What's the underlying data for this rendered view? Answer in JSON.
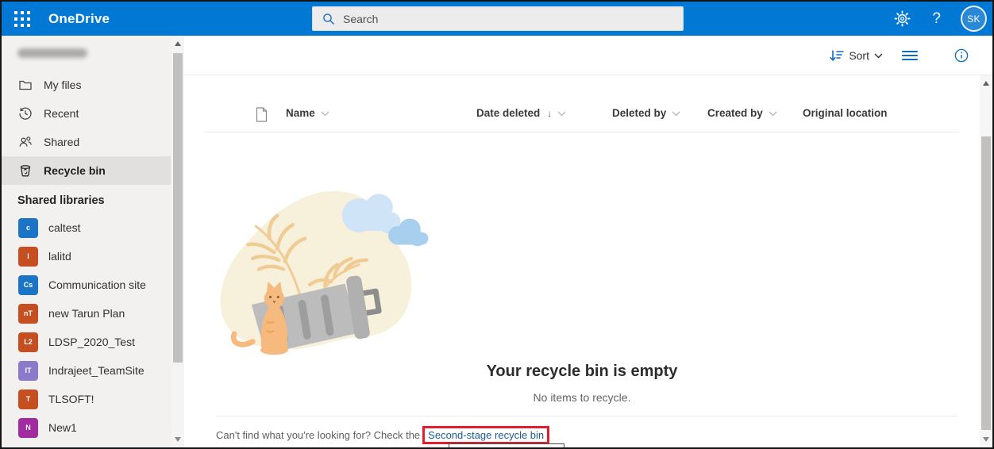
{
  "header": {
    "app_name": "OneDrive",
    "search_placeholder": "Search",
    "help_label": "?",
    "avatar_initials": "SK"
  },
  "sidebar": {
    "nav": [
      {
        "label": "My files",
        "icon": "folder-icon",
        "selected": false
      },
      {
        "label": "Recent",
        "icon": "recent-icon",
        "selected": false
      },
      {
        "label": "Shared",
        "icon": "shared-icon",
        "selected": false
      },
      {
        "label": "Recycle bin",
        "icon": "recycle-bin-icon",
        "selected": true
      }
    ],
    "section_title": "Shared libraries",
    "libraries": [
      {
        "label": "caltest",
        "initials": "c",
        "color": "#1b74c6"
      },
      {
        "label": "lalitd",
        "initials": "l",
        "color": "#c64f21"
      },
      {
        "label": "Communication site",
        "initials": "Cs",
        "color": "#1b74c6"
      },
      {
        "label": "new Tarun Plan",
        "initials": "nT",
        "color": "#c64f21"
      },
      {
        "label": "LDSP_2020_Test",
        "initials": "L2",
        "color": "#c64f21"
      },
      {
        "label": "Indrajeet_TeamSite",
        "initials": "IT",
        "color": "#8b79c9"
      },
      {
        "label": "TLSOFT!",
        "initials": "T",
        "color": "#c64f21"
      },
      {
        "label": "New1",
        "initials": "N",
        "color": "#a22ba2"
      }
    ]
  },
  "toolbar": {
    "sort_label": "Sort"
  },
  "table": {
    "columns": [
      {
        "label": "Name",
        "sortable": true
      },
      {
        "label": "Date deleted",
        "sortable": true,
        "sorted": "descending",
        "sort_glyph": "↓"
      },
      {
        "label": "Deleted by",
        "sortable": true
      },
      {
        "label": "Created by",
        "sortable": true
      },
      {
        "label": "Original location",
        "sortable": false
      }
    ],
    "rows": []
  },
  "empty_state": {
    "title": "Your recycle bin is empty",
    "subtitle": "No items to recycle."
  },
  "footer": {
    "message": "Can't find what you're looking for? Check the",
    "link_label": "Second-stage recycle bin",
    "annotation": "red highlight box around link"
  },
  "colors": {
    "header_bg": "#0078d4",
    "accent": "#0078d4",
    "annotation_red": "#e51c29",
    "sidebar_bg": "#f2f1f0",
    "selected_row_bg": "#e2e0df"
  }
}
